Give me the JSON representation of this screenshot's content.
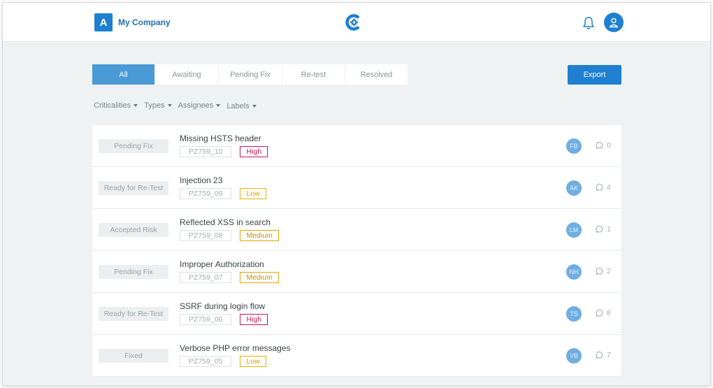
{
  "header": {
    "brand_initial": "A",
    "brand_name": "My Company"
  },
  "tabs": [
    {
      "label": "All",
      "active": true
    },
    {
      "label": "Awaiting",
      "active": false
    },
    {
      "label": "Pending Fix",
      "active": false
    },
    {
      "label": "Re-test",
      "active": false
    },
    {
      "label": "Resolved",
      "active": false
    }
  ],
  "export_label": "Export",
  "filters": [
    {
      "label": "Criticalities"
    },
    {
      "label": "Types"
    },
    {
      "label": "Assignees"
    },
    {
      "label": "Labels"
    }
  ],
  "issues": [
    {
      "status": "Pending Fix",
      "title": "Missing HSTS header",
      "code": "PZ759_10",
      "severity": "High",
      "severity_level": "high",
      "assignee": "FB",
      "comments": "0"
    },
    {
      "status": "Ready for Re-Test",
      "title": "Injection 23",
      "code": "PZ759_09",
      "severity": "Low",
      "severity_level": "low",
      "assignee": "AK",
      "comments": "4"
    },
    {
      "status": "Accepted Risk",
      "title": "Reflected XSS in search",
      "code": "PZ759_08",
      "severity": "Medium",
      "severity_level": "medium",
      "assignee": "LM",
      "comments": "1"
    },
    {
      "status": "Pending Fix",
      "title": "Improper Authorization",
      "code": "PZ759_07",
      "severity": "Medium",
      "severity_level": "medium",
      "assignee": "NH",
      "comments": "2"
    },
    {
      "status": "Ready for Re-Test",
      "title": "SSRF during login flow",
      "code": "PZ759_06",
      "severity": "High",
      "severity_level": "high",
      "assignee": "TS",
      "comments": "8"
    },
    {
      "status": "Fixed",
      "title": "Verbose PHP error messages",
      "code": "PZ759_05",
      "severity": "Low",
      "severity_level": "low",
      "assignee": "VB",
      "comments": "7"
    }
  ],
  "colors": {
    "primary": "#1f7fd0",
    "tab_active": "#4a9ad6",
    "high": "#c2185b",
    "medium": "#e8a100",
    "low": "#e8b000",
    "avatar": "#6eaee3"
  },
  "icons": {
    "logo": "c-gear-logo-icon",
    "bell": "bell-icon",
    "user": "user-icon",
    "comment": "comment-bubble-icon",
    "caret": "caret-down-icon"
  }
}
